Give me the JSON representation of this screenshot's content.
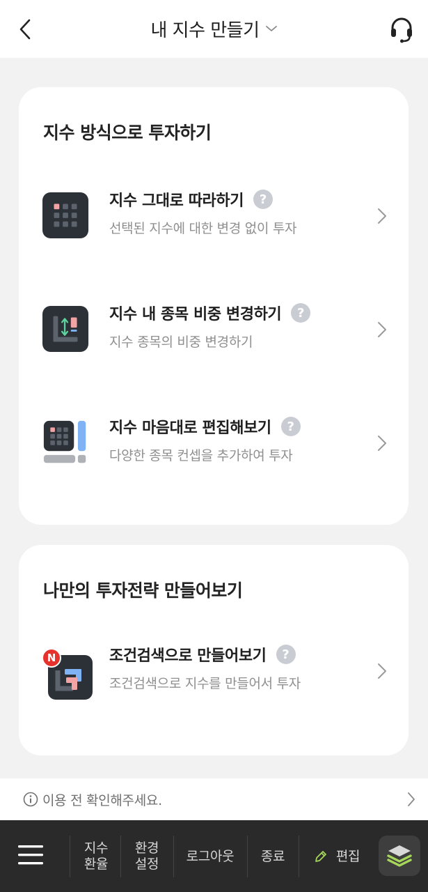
{
  "header": {
    "title": "내 지수 만들기",
    "back_icon": "chevron-left-icon",
    "dropdown_icon": "chevron-down-icon",
    "help_icon": "headset-icon"
  },
  "card_index": {
    "title": "지수 방식으로 투자하기",
    "options": [
      {
        "title": "지수 그대로 따라하기",
        "desc": "선택된 지수에 대한 변경 없이 투자",
        "icon": "grid-icon"
      },
      {
        "title": "지수 내 종목 비중 변경하기",
        "desc": "지수 종목의 비중 변경하기",
        "icon": "weight-adjust-icon"
      },
      {
        "title": "지수 마음대로 편집해보기",
        "desc": "다양한 종목 컨셉을 추가하여 투자",
        "icon": "edit-index-icon"
      }
    ]
  },
  "card_strategy": {
    "title": "나만의 투자전략 만들어보기",
    "options": [
      {
        "title": "조건검색으로 만들어보기",
        "desc": "조건검색으로 지수를 만들어서 투자",
        "icon": "condition-search-icon",
        "badge": "N"
      }
    ]
  },
  "help_mark": "?",
  "notice": {
    "text": "이용 전 확인해주세요."
  },
  "bottom_nav": {
    "item1_line1": "지수",
    "item1_line2": "환율",
    "item2_line1": "환경",
    "item2_line2": "설정",
    "logout": "로그아웃",
    "exit": "종료",
    "edit": "편집"
  },
  "colors": {
    "accent_green": "#a6d65a",
    "icon_dark": "#2c3138",
    "icon_pink": "#f2a3a3",
    "icon_blue": "#7fb3f5",
    "badge_red": "#e5322d"
  }
}
